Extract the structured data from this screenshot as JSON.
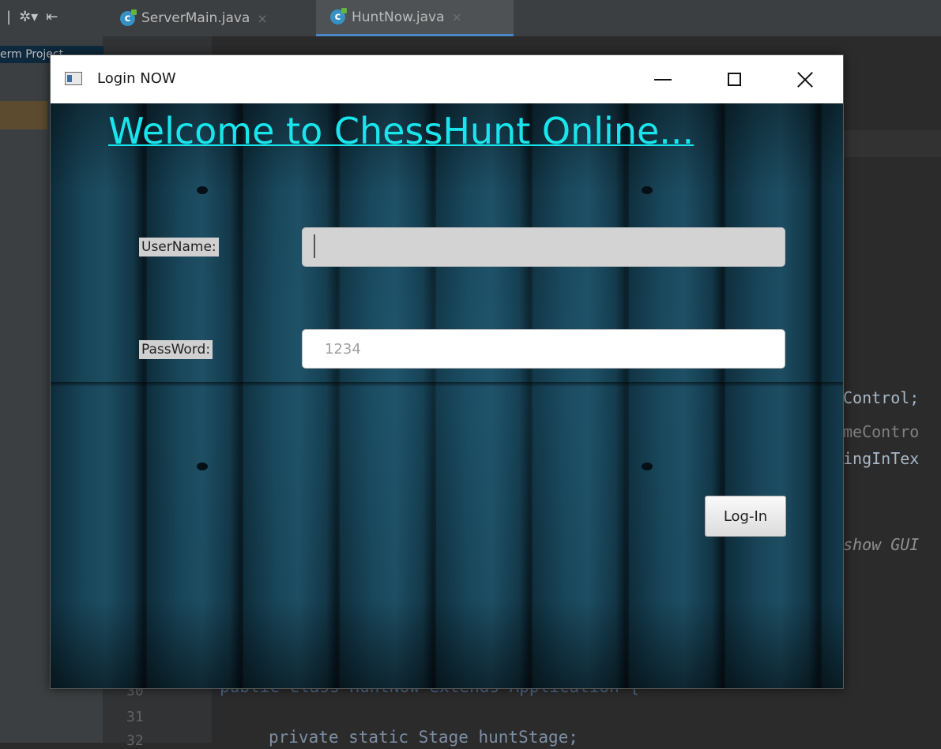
{
  "ide": {
    "tabs": [
      {
        "label": "ServerMain.java",
        "close": "×"
      },
      {
        "label": "HuntNow.java",
        "close": "×"
      }
    ],
    "project_label": "erm Project",
    "code_right": [
      "Control;",
      "meContro",
      "ingInTex",
      "show GUI"
    ],
    "line_numbers": [
      "30",
      "31",
      "32"
    ],
    "code_bottom": {
      "line30": "public class HuntNow extends Application {",
      "line32": "private static Stage huntStage;"
    }
  },
  "window": {
    "title": "Login NOW",
    "welcome": "Welcome to ChessHunt Online...",
    "username_label": "UserName:",
    "username_value": "",
    "password_label": "PassWord:",
    "password_placeholder": "1234",
    "login_button": "Log-In"
  },
  "colors": {
    "welcome_text": "#19e6ec",
    "wood_background": "#184457",
    "ide_background": "#2b2b2b"
  }
}
